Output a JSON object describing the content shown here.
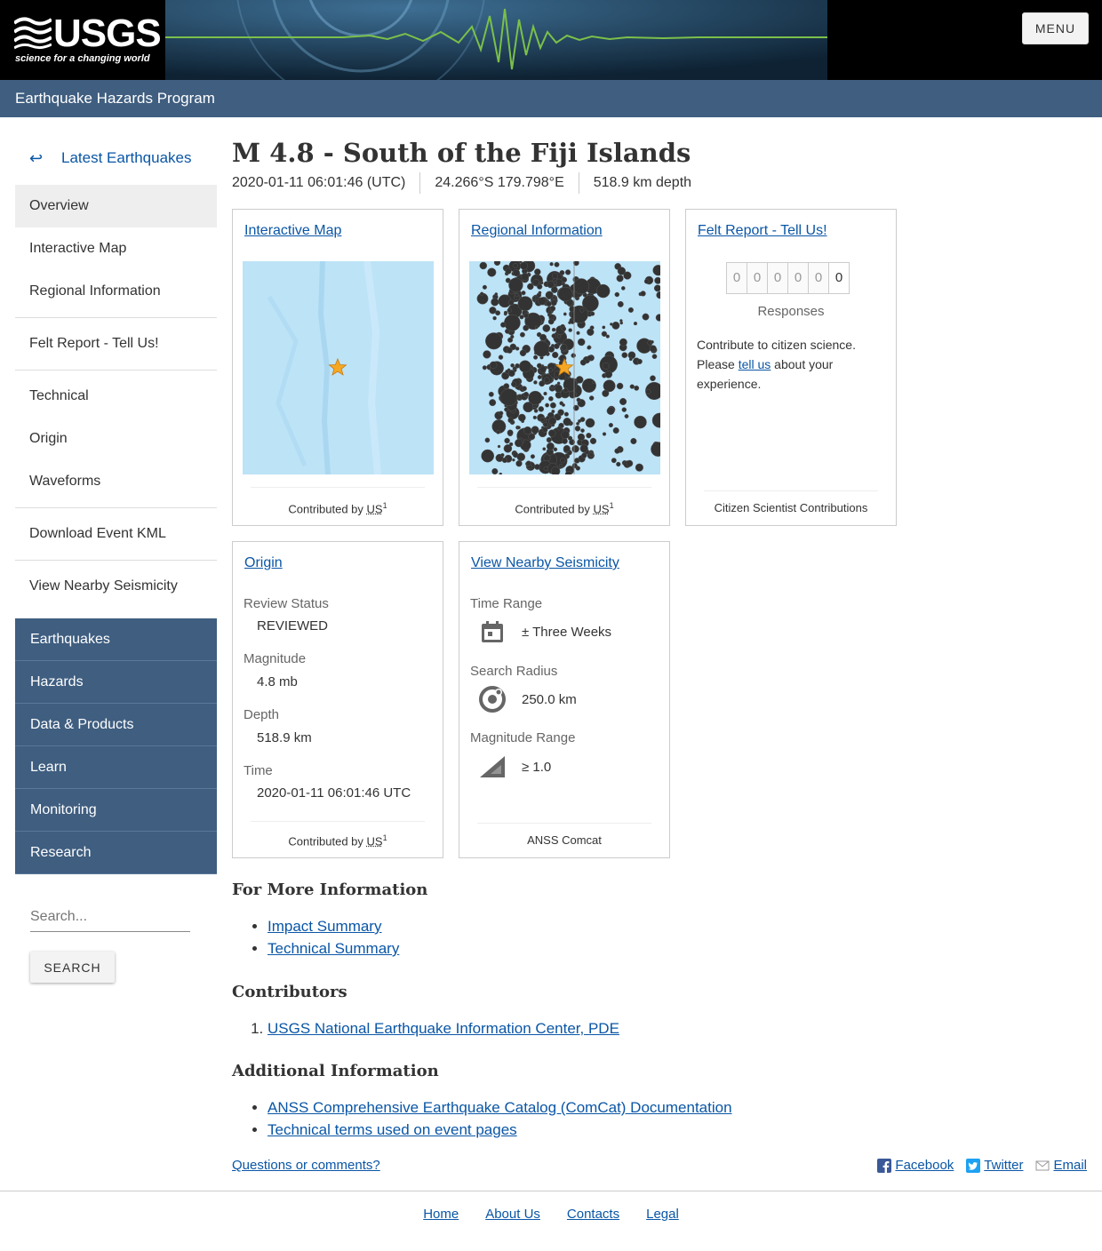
{
  "header": {
    "logo_text": "USGS",
    "logo_tagline": "science for a changing world",
    "menu_label": "MENU",
    "program_title": "Earthquake Hazards Program"
  },
  "sidebar": {
    "back_label": "Latest Earthquakes",
    "items": [
      {
        "label": "Overview"
      },
      {
        "label": "Interactive Map"
      },
      {
        "label": "Regional Information"
      },
      {
        "label": "Felt Report - Tell Us!"
      },
      {
        "label": "Technical"
      },
      {
        "label": "Origin"
      },
      {
        "label": "Waveforms"
      },
      {
        "label": "Download Event KML"
      },
      {
        "label": "View Nearby Seismicity"
      }
    ],
    "site_nav": [
      {
        "label": "Earthquakes"
      },
      {
        "label": "Hazards"
      },
      {
        "label": "Data & Products"
      },
      {
        "label": "Learn"
      },
      {
        "label": "Monitoring"
      },
      {
        "label": "Research"
      }
    ],
    "search_placeholder": "Search...",
    "search_button": "SEARCH"
  },
  "event": {
    "title": "M 4.8 - South of the Fiji Islands",
    "time": "2020-01-11 06:01:46 (UTC)",
    "location": "24.266°S 179.798°E",
    "depth": "518.9 km depth"
  },
  "cards": {
    "interactive_map": {
      "title": "Interactive Map",
      "contributed_prefix": "Contributed by",
      "contributor": "US",
      "sup": "1"
    },
    "regional": {
      "title": "Regional Information",
      "contributed_prefix": "Contributed by",
      "contributor": "US",
      "sup": "1"
    },
    "felt": {
      "title": "Felt Report - Tell Us!",
      "digits": [
        "0",
        "0",
        "0",
        "0",
        "0",
        "0"
      ],
      "responses_label": "Responses",
      "text_before": "Contribute to citizen science. Please",
      "link": "tell us",
      "text_after": "about your experience.",
      "footer": "Citizen Scientist Contributions"
    },
    "origin": {
      "title": "Origin",
      "review_status_label": "Review Status",
      "review_status": "REVIEWED",
      "magnitude_label": "Magnitude",
      "magnitude": "4.8 mb",
      "depth_label": "Depth",
      "depth": "518.9 km",
      "time_label": "Time",
      "time": "2020-01-11 06:01:46 UTC",
      "contributed_prefix": "Contributed by",
      "contributor": "US",
      "sup": "1"
    },
    "nearby": {
      "title": "View Nearby Seismicity",
      "time_range_label": "Time Range",
      "time_range": "± Three Weeks",
      "radius_label": "Search Radius",
      "radius": "250.0 km",
      "mag_range_label": "Magnitude Range",
      "mag_range": "≥ 1.0",
      "footer": "ANSS Comcat"
    }
  },
  "more_info": {
    "heading": "For More Information",
    "links": [
      "Impact Summary",
      "Technical Summary"
    ]
  },
  "contributors": {
    "heading": "Contributors",
    "links": [
      "USGS National Earthquake Information Center, PDE"
    ]
  },
  "additional": {
    "heading": "Additional Information",
    "links": [
      "ANSS Comprehensive Earthquake Catalog (ComCat) Documentation",
      "Technical terms used on event pages"
    ]
  },
  "footer": {
    "questions": "Questions or comments?",
    "social": [
      "Facebook",
      "Twitter",
      "Email"
    ],
    "links": [
      "Home",
      "About Us",
      "Contacts",
      "Legal"
    ]
  },
  "colors": {
    "nav_blue": "#3f5e80",
    "link": "#0a56a6",
    "map_water": "#bde3f7",
    "event_star": "#f7a823"
  }
}
